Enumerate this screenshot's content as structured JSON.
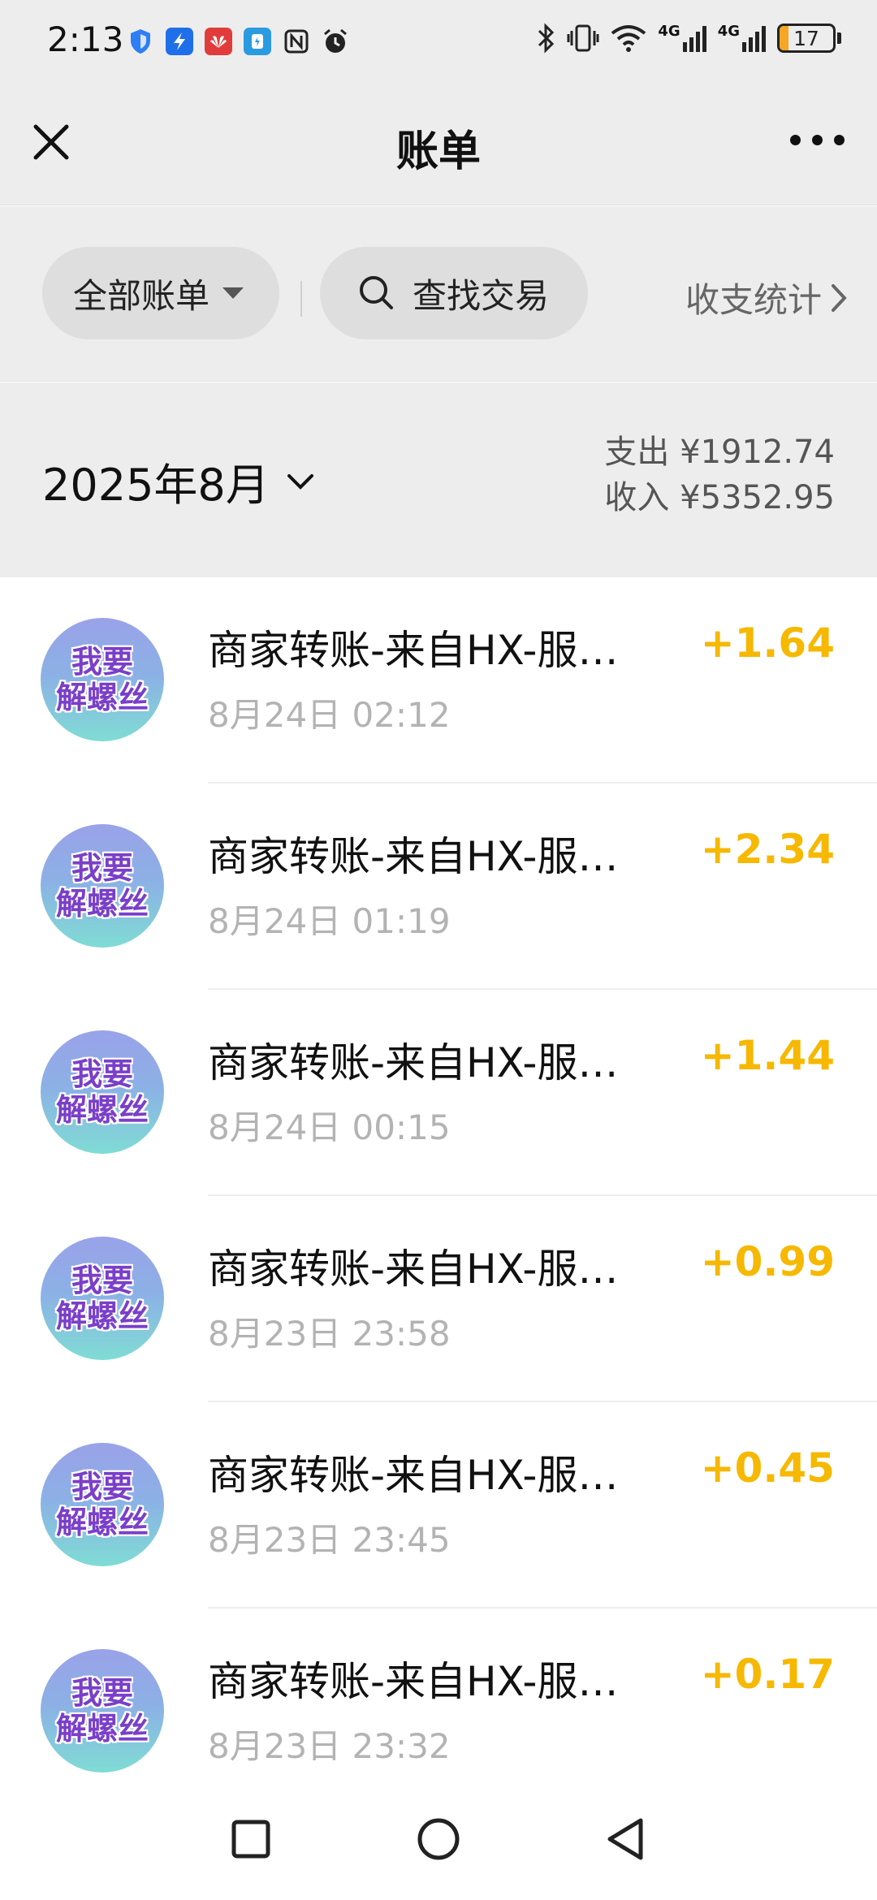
{
  "status_bar": {
    "time": "2:13",
    "battery": "17",
    "battery_level": 0.17,
    "battery_color": "#f5a623",
    "signal_1": "4G",
    "signal_2": "4G",
    "left_icons": [
      "shield-icon",
      "app-blue-icon",
      "huawei-icon",
      "app-cyan-icon",
      "nfc-icon",
      "alarm-icon"
    ],
    "right_icons": [
      "bluetooth-icon",
      "vibrate-icon",
      "wifi-icon",
      "signal-4g-icon",
      "signal-4g-icon",
      "battery-icon"
    ]
  },
  "header": {
    "title": "账单",
    "close_icon": "close-icon",
    "more_icon": "more-icon"
  },
  "filters": {
    "all_bills": "全部账单",
    "search": "查找交易",
    "stats": "收支统计"
  },
  "summary": {
    "month": "2025年8月",
    "expense_label": "支出",
    "expense_value": "¥1912.74",
    "income_label": "收入",
    "income_value": "¥5352.95"
  },
  "avatar": {
    "line1": "我要",
    "line2": "解螺丝"
  },
  "transactions": [
    {
      "title": "商家转账-来自HX-服…",
      "time": "8月24日 02:12",
      "amount": "+1.64"
    },
    {
      "title": "商家转账-来自HX-服…",
      "time": "8月24日 01:19",
      "amount": "+2.34"
    },
    {
      "title": "商家转账-来自HX-服…",
      "time": "8月24日 00:15",
      "amount": "+1.44"
    },
    {
      "title": "商家转账-来自HX-服…",
      "time": "8月23日 23:58",
      "amount": "+0.99"
    },
    {
      "title": "商家转账-来自HX-服…",
      "time": "8月23日 23:45",
      "amount": "+0.45"
    },
    {
      "title": "商家转账-来自HX-服…",
      "time": "8月23日 23:32",
      "amount": "+0.17"
    }
  ],
  "colors": {
    "income_amount": "#f6b800",
    "header_bg": "#ededed",
    "avatar_text": "#7a3fc9"
  },
  "nav": [
    "recents-square-icon",
    "home-circle-icon",
    "back-triangle-icon"
  ]
}
